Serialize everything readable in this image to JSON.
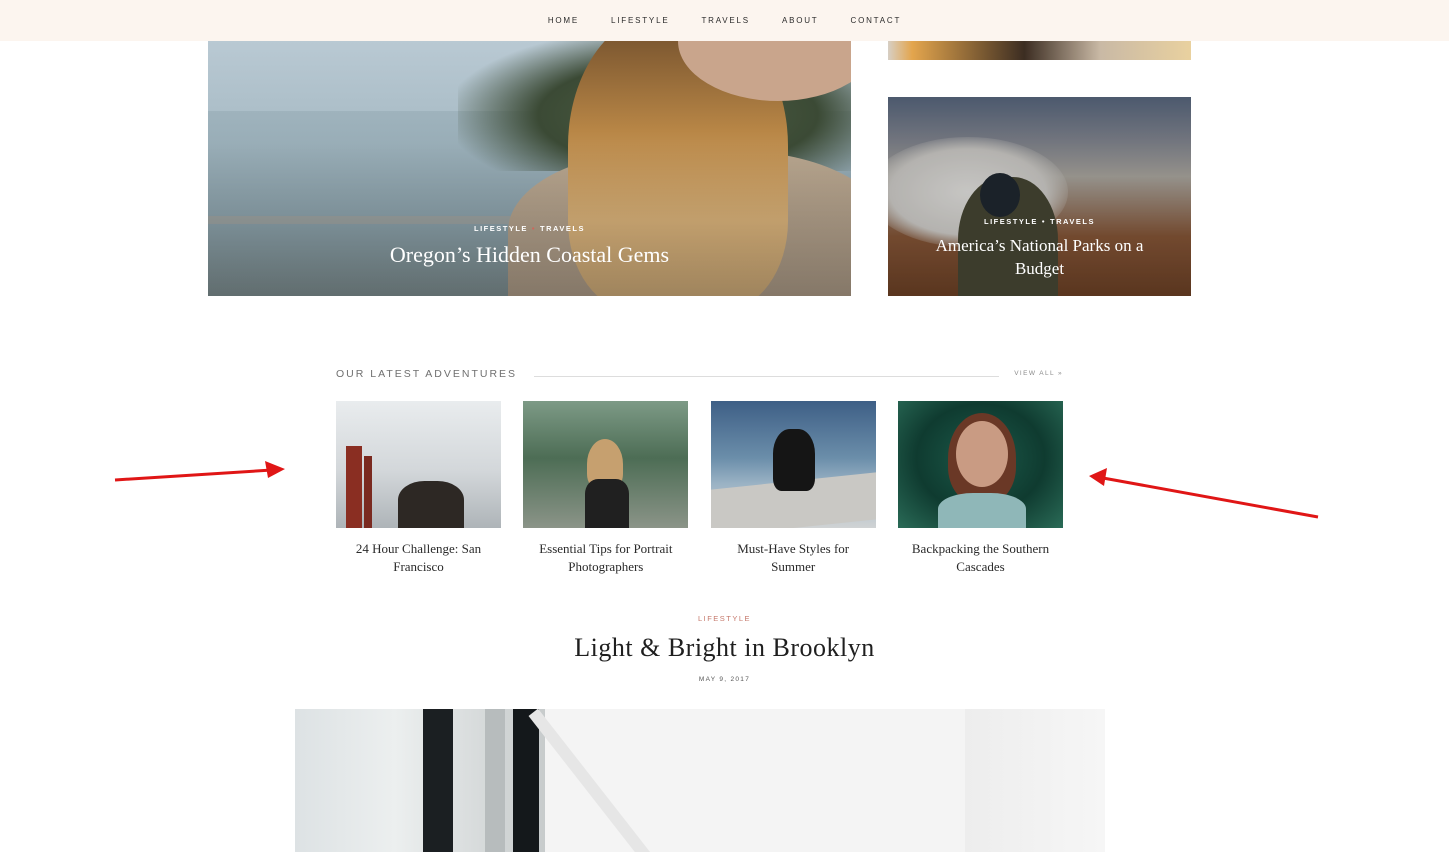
{
  "nav": {
    "items": [
      "HOME",
      "LIFESTYLE",
      "TRAVELS",
      "ABOUT",
      "CONTACT"
    ]
  },
  "featured": {
    "main": {
      "category1": "LIFESTYLE",
      "separator": "•",
      "category2": "TRAVELS",
      "title": "Oregon’s Hidden Coastal Gems"
    },
    "side": {
      "category1": "LIFESTYLE",
      "separator": "•",
      "category2": "TRAVELS",
      "title": "America’s National Parks on a Budget"
    }
  },
  "latest": {
    "heading": "OUR LATEST ADVENTURES",
    "view_all": "VIEW ALL »",
    "items": [
      {
        "title": "24 Hour Challenge: San Francisco"
      },
      {
        "title": "Essential Tips for Portrait Photographers"
      },
      {
        "title": "Must-Have Styles for Summer"
      },
      {
        "title": "Backpacking the Southern Cascades"
      }
    ]
  },
  "post": {
    "category": "LIFESTYLE",
    "title": "Light & Bright in Brooklyn",
    "date": "MAY 9, 2017"
  },
  "colors": {
    "nav_bg": "#fcf5ef",
    "accent": "#d0645a",
    "arrow": "#e01616"
  }
}
